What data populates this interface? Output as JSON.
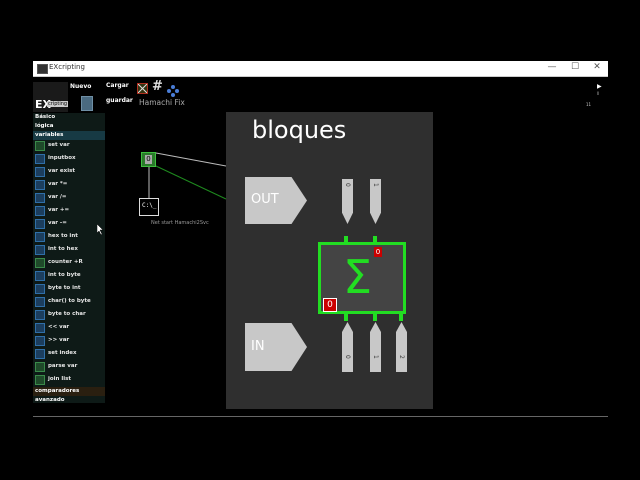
{
  "window": {
    "title": "EXcripting",
    "controls": {
      "minimize": "—",
      "maximize": "☐",
      "close": "✕"
    }
  },
  "toolbar": {
    "logo": "EX",
    "logo_sub": "cripting",
    "nuevo": "Nuevo",
    "cargar": "Cargar",
    "guardar": "guardar",
    "project_name": "Hamachi Fix",
    "right_indicator": "11"
  },
  "sidebar": {
    "categories_top": [
      "Básico",
      "lógica",
      "variables"
    ],
    "items": [
      "set var",
      "inputbox",
      "var exist",
      "var *=",
      "var /=",
      "var +=",
      "var -=",
      "hex to int",
      "int to hex",
      "counter +R",
      "int to byte",
      "byte to int",
      "char() to byte",
      "byte to char",
      "<< var",
      ">> var",
      "set index",
      "parse var",
      "join list"
    ],
    "categories_bottom": [
      "comparadores",
      "avanzado"
    ]
  },
  "canvas": {
    "node_value": "0",
    "cmd_label": "Net start Hamachi2Svc",
    "panel_title": "bloques",
    "out_label": "OUT",
    "in_label": "IN",
    "out_ports": [
      "0",
      "1"
    ],
    "in_ports": [
      "0",
      "1",
      "2"
    ],
    "sum_symbol": "Σ",
    "badge_top": "0",
    "badge_bottom": "0"
  },
  "colors": {
    "accent_green": "#22dd22",
    "badge_red": "#cc0000",
    "panel_bg": "#2f2f2f",
    "sidebar_bg": "#0e1a17"
  }
}
